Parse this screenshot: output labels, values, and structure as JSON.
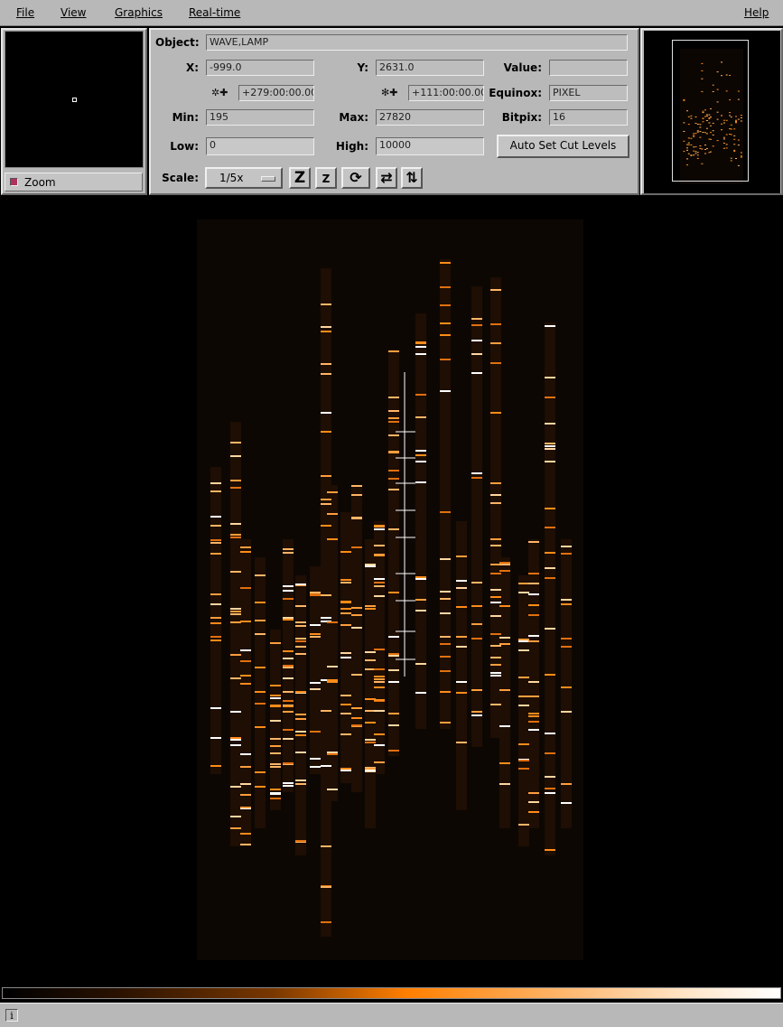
{
  "menu": {
    "file": "File",
    "view": "View",
    "graphics": "Graphics",
    "realtime": "Real-time",
    "help": "Help"
  },
  "zoom": {
    "toggle_label": "Zoom"
  },
  "info": {
    "object_label": "Object:",
    "object_value": "WAVE,LAMP",
    "x_label": "X:",
    "x_value": "-999.0",
    "y_label": "Y:",
    "y_value": "2631.0",
    "value_label": "Value:",
    "value_value": "",
    "ra_value": "+279:00:00.00",
    "dec_value": "+111:00:00.00",
    "equinox_label": "Equinox:",
    "equinox_value": "PIXEL",
    "min_label": "Min:",
    "min_value": "195",
    "max_label": "Max:",
    "max_value": "27820",
    "bitpix_label": "Bitpix:",
    "bitpix_value": "16",
    "low_label": "Low:",
    "low_value": "0",
    "high_label": "High:",
    "high_value": "10000",
    "auto_cut_label": "Auto Set Cut Levels",
    "scale_label": "Scale:",
    "scale_value": "1/5x"
  },
  "toolbar_icons": [
    "zoom-in-icon",
    "zoom-out-icon",
    "rotate-icon",
    "flip-x-icon",
    "flip-y-icon"
  ],
  "colors": {
    "panel": "#b8b8b8",
    "image_bg": "#000000",
    "line_orange": "#ff8c1a",
    "line_white": "#ffffff"
  },
  "status": {
    "info_icon": "info-icon"
  }
}
